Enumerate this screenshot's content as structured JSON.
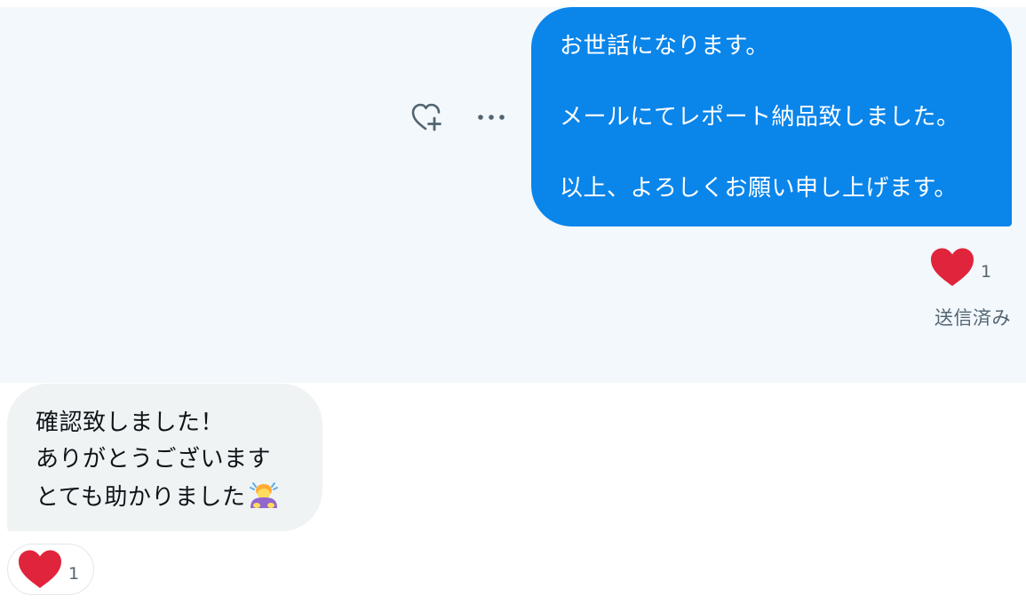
{
  "sent_message": {
    "lines": [
      "お世話になります。",
      "メールにてレポート納品致しました。",
      "以上、よろしくお願い申し上げます。"
    ],
    "reaction_icon": "heart-icon",
    "reaction_count": "1",
    "status": "送信済み",
    "actions": {
      "add_reaction_icon": "heart-plus-icon",
      "more_icon": "more-horizontal-icon"
    }
  },
  "received_message": {
    "lines": [
      "確認致しました！",
      "ありがとうございます",
      "とても助かりました"
    ],
    "emoji": "person-bowing-emoji",
    "reaction_icon": "heart-icon",
    "reaction_count": "1"
  },
  "colors": {
    "sent_bubble": "#0a85ea",
    "received_bubble": "#eff3f4",
    "sent_area_bg": "#f2f8fc",
    "heart": "#e0243b"
  }
}
